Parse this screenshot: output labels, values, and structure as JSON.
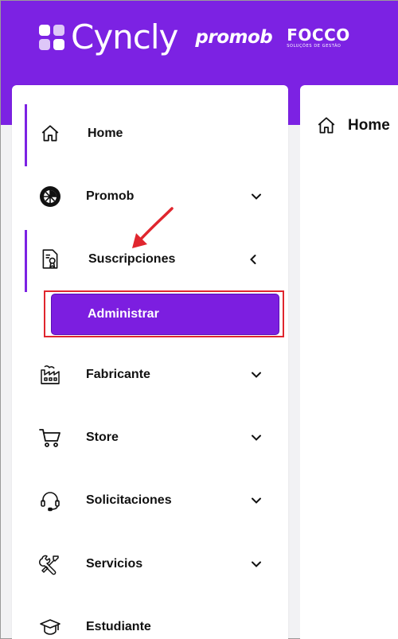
{
  "header": {
    "brand": "Cyncly",
    "partner1": "promob",
    "partner2": "FOCCO",
    "partner2_tagline": "SOLUÇÕES DE GESTÃO",
    "bg_color": "#7c22e3"
  },
  "sidebar": {
    "items": [
      {
        "label": "Home",
        "icon": "home-icon",
        "active": true
      },
      {
        "label": "Promob",
        "icon": "promob-logo-icon",
        "chevron": "down"
      },
      {
        "label": "Suscripciones",
        "icon": "certificate-icon",
        "chevron": "left",
        "expanded": true
      },
      {
        "label": "Fabricante",
        "icon": "factory-icon",
        "chevron": "down"
      },
      {
        "label": "Store",
        "icon": "cart-icon",
        "chevron": "down"
      },
      {
        "label": "Solicitaciones",
        "icon": "headset-icon",
        "chevron": "down"
      },
      {
        "label": "Servicios",
        "icon": "tools-icon",
        "chevron": "down"
      },
      {
        "label": "Estudiante",
        "icon": "graduation-cap-icon"
      }
    ],
    "subitems": [
      {
        "label": "Administrar",
        "selected": true
      }
    ]
  },
  "content": {
    "title": "Home"
  },
  "annotation": {
    "arrow_color": "#e0262e",
    "highlight_color": "#e0262e"
  }
}
